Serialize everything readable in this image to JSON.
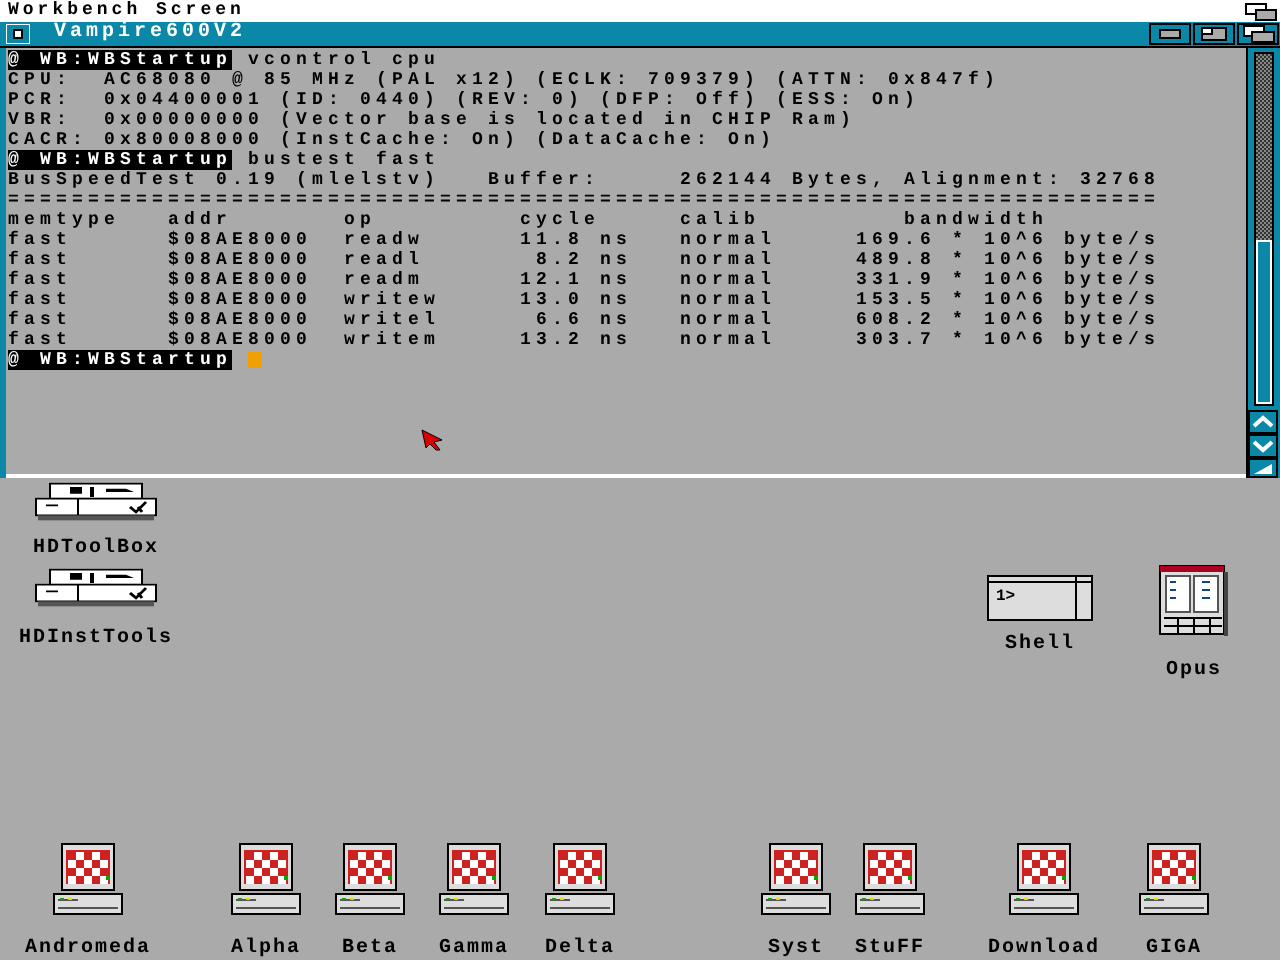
{
  "screen": {
    "title": "Workbench Screen"
  },
  "window": {
    "title": "Vampire600V2",
    "console": [
      {
        "kind": "prompt",
        "prompt": "@ WB:WBStartup",
        "command": "vcontrol cpu"
      },
      {
        "kind": "text",
        "text": "CPU:  AC68080 @ 85 MHz (PAL x12) (ECLK: 709379) (ATTN: 0x847f)"
      },
      {
        "kind": "text",
        "text": "PCR:  0x04400001 (ID: 0440) (REV: 0) (DFP: Off) (ESS: On)"
      },
      {
        "kind": "text",
        "text": "VBR:  0x00000000 (Vector base is located in CHIP Ram)"
      },
      {
        "kind": "text",
        "text": "CACR: 0x80008000 (InstCache: On) (DataCache: On)"
      },
      {
        "kind": "prompt",
        "prompt": "@ WB:WBStartup",
        "command": "bustest fast"
      },
      {
        "kind": "text",
        "text": "BusSpeedTest 0.19 (mlelstv)   Buffer:     262144 Bytes, Alignment: 32768"
      },
      {
        "kind": "rule",
        "text": "========================================================================"
      },
      {
        "kind": "table",
        "columns": [
          "memtype",
          "addr",
          "op",
          "cycle",
          "calib",
          "bandwidth"
        ],
        "rows": [
          [
            "fast",
            "$08AE8000",
            "readw",
            "11.8 ns",
            "normal",
            "169.6 * 10^6 byte/s"
          ],
          [
            "fast",
            "$08AE8000",
            "readl",
            "8.2 ns",
            "normal",
            "489.8 * 10^6 byte/s"
          ],
          [
            "fast",
            "$08AE8000",
            "readm",
            "12.1 ns",
            "normal",
            "331.9 * 10^6 byte/s"
          ],
          [
            "fast",
            "$08AE8000",
            "writew",
            "13.0 ns",
            "normal",
            "153.5 * 10^6 byte/s"
          ],
          [
            "fast",
            "$08AE8000",
            "writel",
            "6.6 ns",
            "normal",
            "608.2 * 10^6 byte/s"
          ],
          [
            "fast",
            "$08AE8000",
            "writem",
            "13.2 ns",
            "normal",
            "303.7 * 10^6 byte/s"
          ]
        ]
      },
      {
        "kind": "prompt",
        "prompt": "@ WB:WBStartup",
        "cursor": true
      }
    ]
  },
  "desktop_icons": [
    {
      "kind": "drive",
      "label": "HDToolBox"
    },
    {
      "kind": "drive",
      "label": "HDInstTools"
    },
    {
      "kind": "shell",
      "label": "Shell",
      "icon_text": "1>"
    },
    {
      "kind": "opus",
      "label": "Opus"
    },
    {
      "kind": "computer",
      "label": "Andromeda"
    },
    {
      "kind": "computer",
      "label": "Alpha"
    },
    {
      "kind": "computer",
      "label": "Beta"
    },
    {
      "kind": "computer",
      "label": "Gamma"
    },
    {
      "kind": "computer",
      "label": "Delta"
    },
    {
      "kind": "computer",
      "label": "Syst"
    },
    {
      "kind": "computer",
      "label": "StuFF"
    },
    {
      "kind": "computer",
      "label": "Download"
    },
    {
      "kind": "computer",
      "label": "GIGA"
    }
  ]
}
